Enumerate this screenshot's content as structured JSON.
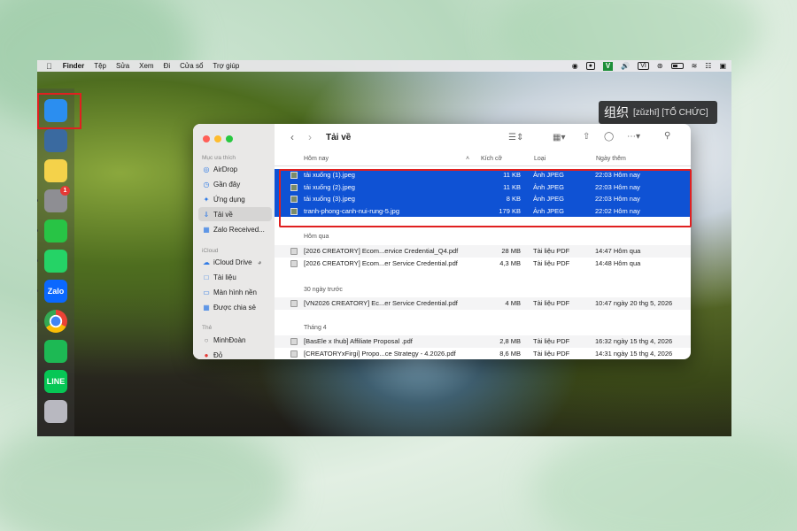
{
  "menubar": {
    "apple": "",
    "app": "Finder",
    "items": [
      "Tệp",
      "Sửa",
      "Xem",
      "Đi",
      "Cửa sổ",
      "Trợ giúp"
    ],
    "v_label": "V",
    "vi_label": "VI"
  },
  "dictionary_popup": {
    "hanzi": "组织",
    "pinyin": "[zǔzhī] [TỔ CHỨC]"
  },
  "dock": {
    "apps": [
      {
        "name": "Finder",
        "color": "#2b8ef0",
        "label": ""
      },
      {
        "name": "Find My",
        "color": "#3a6aa0",
        "label": ""
      },
      {
        "name": "Notes",
        "color": "#f4d24a",
        "label": ""
      },
      {
        "name": "System Settings",
        "color": "#8e8e93",
        "label": "",
        "badge": "1"
      },
      {
        "name": "WeChat",
        "color": "#28c445",
        "label": ""
      },
      {
        "name": "WhatsApp",
        "color": "#25d366",
        "label": ""
      },
      {
        "name": "Zalo",
        "color": "#0a68ff",
        "label": "Zalo"
      },
      {
        "name": "Chrome",
        "color": "#e8e8e8",
        "label": ""
      },
      {
        "name": "Spotify",
        "color": "#1db954",
        "label": ""
      },
      {
        "name": "LINE",
        "color": "#06c755",
        "label": "LINE"
      },
      {
        "name": "Launchpad",
        "color": "#b8b8c0",
        "label": ""
      }
    ]
  },
  "finder": {
    "title": "Tải về",
    "sidebar": {
      "favorites_header": "Mục ưa thích",
      "favorites": [
        "AirDrop",
        "Gần đây",
        "Ứng dụng",
        "Tải về",
        "Zalo Received..."
      ],
      "icloud_header": "iCloud",
      "icloud": [
        "iCloud Drive",
        "Tài liệu",
        "Màn hình nền",
        "Được chia sẻ"
      ],
      "tags_header": "Thẻ",
      "tags": [
        "MinhĐoàn",
        "Đỏ"
      ]
    },
    "columns": {
      "name": "Hôm nay",
      "size": "Kích cỡ",
      "kind": "Loại",
      "date": "Ngày thêm"
    },
    "today": [
      {
        "name": "tải xuống (1).jpeg",
        "size": "11 KB",
        "kind": "Ảnh JPEG",
        "date": "22:03 Hôm nay"
      },
      {
        "name": "tải xuống (2).jpeg",
        "size": "11 KB",
        "kind": "Ảnh JPEG",
        "date": "22:03 Hôm nay"
      },
      {
        "name": "tải xuống (3).jpeg",
        "size": "8 KB",
        "kind": "Ảnh JPEG",
        "date": "22:03 Hôm nay"
      },
      {
        "name": "tranh-phong-canh-nui-rung-5.jpg",
        "size": "179 KB",
        "kind": "Ảnh JPEG",
        "date": "22:02 Hôm nay"
      }
    ],
    "yesterday_header": "Hôm qua",
    "yesterday": [
      {
        "name": "[2026 CREATORY] Ecom...ervice Credential_Q4.pdf",
        "size": "28 MB",
        "kind": "Tài liệu PDF",
        "date": "14:47 Hôm qua"
      },
      {
        "name": "[2026 CREATORY] Ecom...er Service Credential.pdf",
        "size": "4,3 MB",
        "kind": "Tài liệu PDF",
        "date": "14:48 Hôm qua"
      }
    ],
    "days30_header": "30 ngày trước",
    "days30": [
      {
        "name": "[VN2026 CREATORY] Ec...er Service Credential.pdf",
        "size": "4 MB",
        "kind": "Tài liệu PDF",
        "date": "10:47 ngày 20 thg 5, 2026"
      }
    ],
    "april_header": "Tháng 4",
    "april": [
      {
        "name": "[BasEle x Ihub] Affiliate Proposal .pdf",
        "size": "2,8 MB",
        "kind": "Tài liệu PDF",
        "date": "16:32 ngày 15 thg 4, 2026"
      },
      {
        "name": "[CREATORYxFirgi] Propo...ce Strategy - 4.2026.pdf",
        "size": "8,6 MB",
        "kind": "Tài liệu PDF",
        "date": "14:31 ngày 15 thg 4, 2026"
      }
    ]
  },
  "colors": {
    "selection": "#0f52d4",
    "highlight_box": "#e02020",
    "accent": "#2f7ae5"
  }
}
